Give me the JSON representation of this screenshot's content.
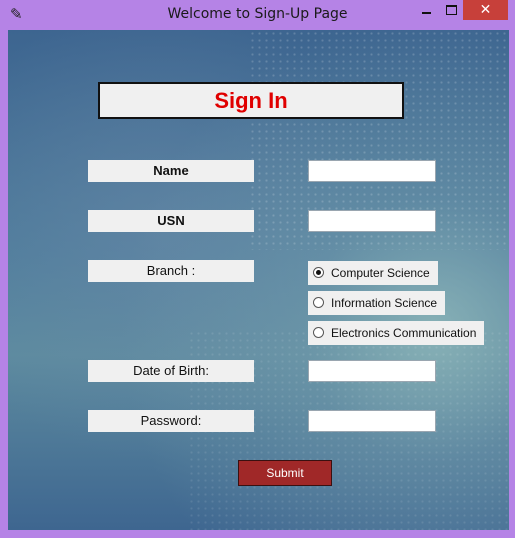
{
  "window": {
    "title": "Welcome to Sign-Up Page",
    "icon": "feather-icon",
    "close_glyph": "✕"
  },
  "form": {
    "heading": "Sign In",
    "name_label": "Name",
    "usn_label": "USN",
    "branch_label": "Branch :",
    "dob_label": "Date of Birth:",
    "password_label": "Password:",
    "branch_options": [
      {
        "label": "Computer Science",
        "checked": true
      },
      {
        "label": "Information Science",
        "checked": false
      },
      {
        "label": "Electronics Communication",
        "checked": false
      }
    ],
    "name_value": "",
    "usn_value": "",
    "dob_value": "",
    "password_value": "",
    "submit_label": "Submit"
  },
  "colors": {
    "titlebar": "#b583e6",
    "heading_text": "#e00000",
    "submit_bg": "#a02828",
    "close_button": "#c7403a"
  }
}
